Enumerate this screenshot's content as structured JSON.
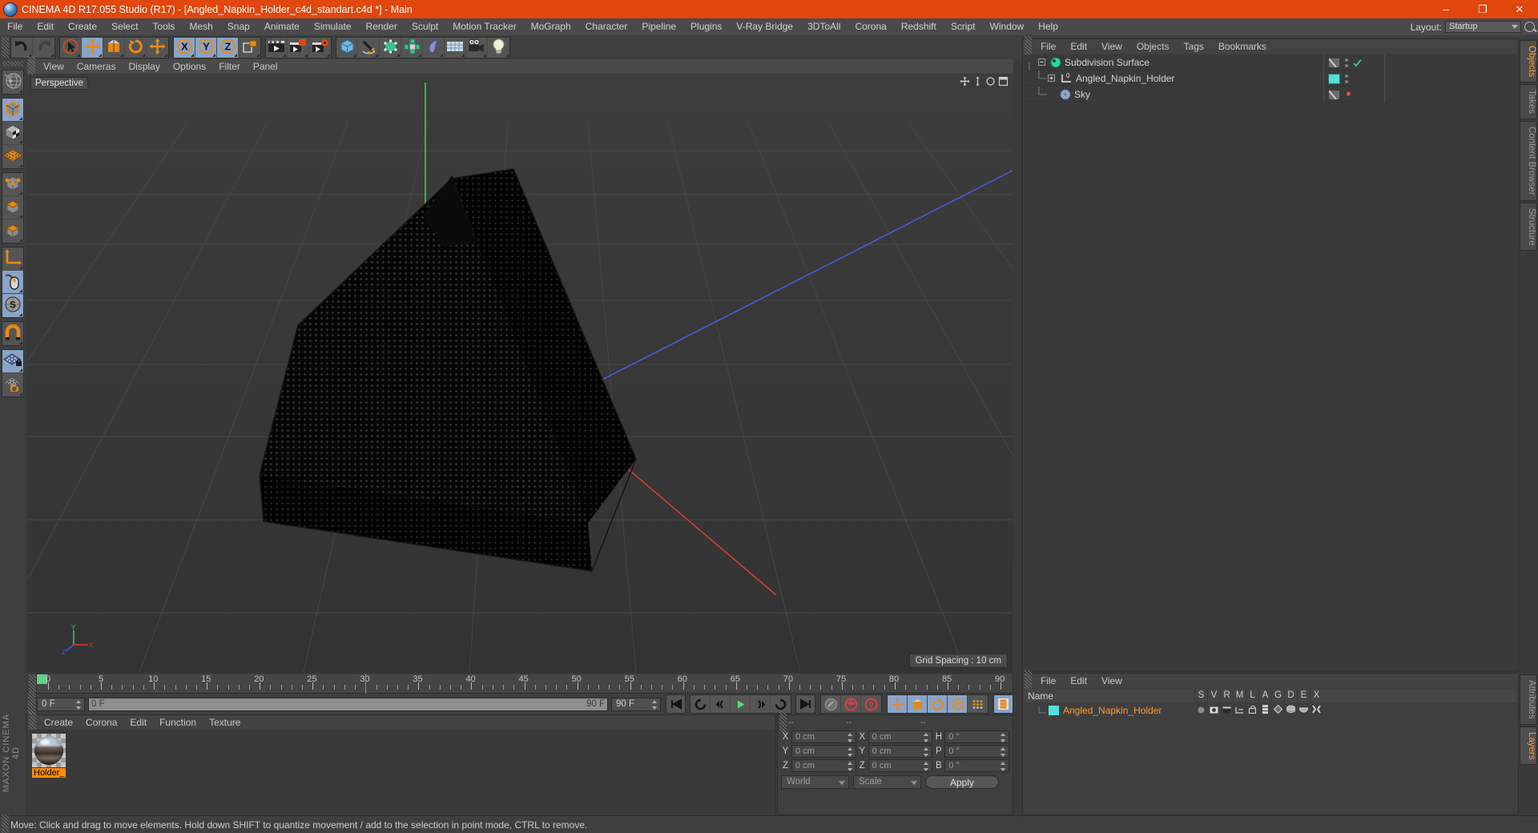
{
  "window": {
    "title": "CINEMA 4D R17.055 Studio (R17) - [Angled_Napkin_Holder_c4d_standart.c4d *] - Main",
    "minimize": "–",
    "maximize": "❐",
    "close": "✕"
  },
  "menubar": {
    "items": [
      "File",
      "Edit",
      "Create",
      "Select",
      "Tools",
      "Mesh",
      "Snap",
      "Animate",
      "Simulate",
      "Render",
      "Sculpt",
      "Motion Tracker",
      "MoGraph",
      "Character",
      "Pipeline",
      "Plugins",
      "V-Ray Bridge",
      "3DToAll",
      "Corona",
      "Redshift",
      "Script",
      "Window",
      "Help"
    ],
    "layout_label": "Layout:",
    "layout_value": "Startup",
    "search_icon": "magnifier-icon"
  },
  "toptoolbar": {
    "groups": [
      {
        "name": "history",
        "buttons": [
          {
            "icon": "undo-icon",
            "selected": false
          },
          {
            "icon": "redo-icon",
            "selected": false
          }
        ]
      },
      {
        "name": "transform",
        "buttons": [
          {
            "icon": "select-cursor-icon",
            "selected": false
          },
          {
            "icon": "move-icon",
            "selected": true
          },
          {
            "icon": "scale-icon",
            "selected": false
          },
          {
            "icon": "rotate-icon",
            "selected": false
          },
          {
            "icon": "move-alt-icon",
            "selected": false
          }
        ]
      },
      {
        "name": "axis-lock",
        "buttons": [
          {
            "icon": "axis-x-icon",
            "selected": true
          },
          {
            "icon": "axis-y-icon",
            "selected": true
          },
          {
            "icon": "axis-z-icon",
            "selected": true
          },
          {
            "icon": "world-coord-icon",
            "selected": false
          }
        ]
      },
      {
        "name": "render",
        "buttons": [
          {
            "icon": "render-view-icon",
            "selected": false
          },
          {
            "icon": "render-picture-viewer-icon",
            "selected": false
          },
          {
            "icon": "render-settings-icon",
            "selected": false
          }
        ]
      },
      {
        "name": "create",
        "buttons": [
          {
            "icon": "cube-primitive-icon",
            "selected": false
          },
          {
            "icon": "spline-pen-icon",
            "selected": false
          },
          {
            "icon": "nurbs-icon",
            "selected": false
          },
          {
            "icon": "mograph-icon",
            "selected": false
          },
          {
            "icon": "deformer-icon",
            "selected": false
          },
          {
            "icon": "scene-grid-icon",
            "selected": false
          },
          {
            "icon": "camera-icon",
            "selected": false
          },
          {
            "icon": "light-icon",
            "selected": false
          }
        ]
      }
    ]
  },
  "lefttoolbar": {
    "groups": [
      {
        "buttons": [
          {
            "icon": "live-selection-globe-icon",
            "selected": false
          }
        ]
      },
      {
        "buttons": [
          {
            "icon": "model-mode-icon",
            "selected": true
          },
          {
            "icon": "texture-mode-icon",
            "selected": false
          },
          {
            "icon": "workplane-mode-icon",
            "selected": false
          }
        ]
      },
      {
        "buttons": [
          {
            "icon": "point-mode-icon",
            "selected": false
          },
          {
            "icon": "edge-mode-icon",
            "selected": false
          },
          {
            "icon": "polygon-mode-icon",
            "selected": false
          }
        ]
      },
      {
        "buttons": [
          {
            "icon": "axis-modify-icon",
            "selected": false
          },
          {
            "icon": "viewport-mouse-icon",
            "selected": true
          },
          {
            "icon": "enable-snap-icon",
            "selected": true
          }
        ]
      },
      {
        "buttons": [
          {
            "icon": "magnet-icon",
            "selected": false
          }
        ]
      },
      {
        "buttons": [
          {
            "icon": "workplane-lock-icon",
            "selected": true
          },
          {
            "icon": "workplane-rotate-icon",
            "selected": false
          }
        ]
      }
    ],
    "brand": "MAXON CINEMA 4D"
  },
  "viewport": {
    "menu": [
      "View",
      "Cameras",
      "Display",
      "Options",
      "Filter",
      "Panel"
    ],
    "label": "Perspective",
    "grid_spacing": "Grid Spacing : 10 cm",
    "axis_gizmo": {
      "x": "X",
      "y": "Y",
      "z": "Z"
    },
    "nav_icons": [
      "pan-icon",
      "zoom-icon",
      "rotate-icon",
      "maximize-view-icon"
    ]
  },
  "timeline": {
    "ticks": [
      0,
      5,
      10,
      15,
      20,
      25,
      30,
      35,
      40,
      45,
      50,
      55,
      60,
      65,
      70,
      75,
      80,
      85,
      90
    ],
    "current_frame": "0 F",
    "range_start": "0 F",
    "range_end": "90 F",
    "end_frame": "90 F",
    "playhead": 0,
    "transport": [
      {
        "icon": "go-to-start-icon"
      },
      {
        "icon": "rewind-loop-icon"
      },
      {
        "icon": "prev-key-icon"
      },
      {
        "icon": "play-icon"
      },
      {
        "icon": "next-key-icon"
      },
      {
        "icon": "forward-loop-icon"
      },
      {
        "icon": "go-to-end-icon"
      }
    ],
    "record_group": [
      {
        "icon": "autokey-icon",
        "selected": false
      },
      {
        "icon": "record-active-objects-icon",
        "selected": false
      },
      {
        "icon": "record-question-icon",
        "selected": false
      }
    ],
    "keyframe_group": [
      {
        "icon": "key-position-icon",
        "selected": true
      },
      {
        "icon": "key-scale-icon",
        "selected": true
      },
      {
        "icon": "key-rotation-icon",
        "selected": true
      },
      {
        "icon": "key-param-icon",
        "selected": true
      },
      {
        "icon": "key-pla-icon",
        "selected": false
      }
    ],
    "filmstrip_icon": "filmstrip-icon"
  },
  "material_manager": {
    "menu": [
      "Create",
      "Corona",
      "Edit",
      "Function",
      "Texture"
    ],
    "materials": [
      {
        "name": "Holder_",
        "preview": "chrome-sphere-preview"
      }
    ]
  },
  "coordinates": {
    "header": [
      "--",
      "--",
      "--"
    ],
    "rows": [
      {
        "pos_label": "X",
        "pos_value": "0 cm",
        "size_label": "X",
        "size_value": "0 cm",
        "rot_label": "H",
        "rot_value": "0 °"
      },
      {
        "pos_label": "Y",
        "pos_value": "0 cm",
        "size_label": "Y",
        "size_value": "0 cm",
        "rot_label": "P",
        "rot_value": "0 °"
      },
      {
        "pos_label": "Z",
        "pos_value": "0 cm",
        "size_label": "Z",
        "size_value": "0 cm",
        "rot_label": "B",
        "rot_value": "0 °"
      }
    ],
    "coord_system": "World",
    "mode": "Scale",
    "apply_label": "Apply"
  },
  "object_manager": {
    "menu": [
      "File",
      "Edit",
      "View",
      "Objects",
      "Tags",
      "Bookmarks"
    ],
    "objects": [
      {
        "name": "Subdivision Surface",
        "icon": "subdivision-surface-icon",
        "indent": 0,
        "expander": "minus",
        "tag": "checkmark",
        "color": null
      },
      {
        "name": "Angled_Napkin_Holder",
        "icon": "null-object-icon",
        "indent": 1,
        "expander": "plus",
        "tag": "none",
        "color": "#53e0da"
      },
      {
        "name": "Sky",
        "icon": "sky-object-icon",
        "indent": 1,
        "expander": "end",
        "tag": "reddot",
        "color": null
      }
    ]
  },
  "layer_manager": {
    "menu": [
      "File",
      "Edit",
      "View"
    ],
    "name_column": "Name",
    "columns": [
      "S",
      "V",
      "R",
      "M",
      "L",
      "A",
      "G",
      "D",
      "E",
      "X"
    ],
    "rows": [
      {
        "name": "Angled_Napkin_Holder",
        "color": "#53e0da"
      }
    ]
  },
  "right_tabs": {
    "upper": [
      {
        "label": "Objects",
        "active": true
      },
      {
        "label": "Takes",
        "active": false
      },
      {
        "label": "Content Browser",
        "active": false
      },
      {
        "label": "Structure",
        "active": false
      }
    ],
    "lower": [
      {
        "label": "Attributes",
        "active": false
      },
      {
        "label": "Layers",
        "active": true
      }
    ]
  },
  "statusbar": {
    "text": "Move: Click and drag to move elements. Hold down SHIFT to quantize movement / add to the selection in point mode, CTRL to remove."
  },
  "colors": {
    "accent_orange": "#e2470d",
    "selected_blue": "#8aa4c8",
    "highlight_orange": "#ff9b2e",
    "object_cyan": "#53e0da"
  }
}
